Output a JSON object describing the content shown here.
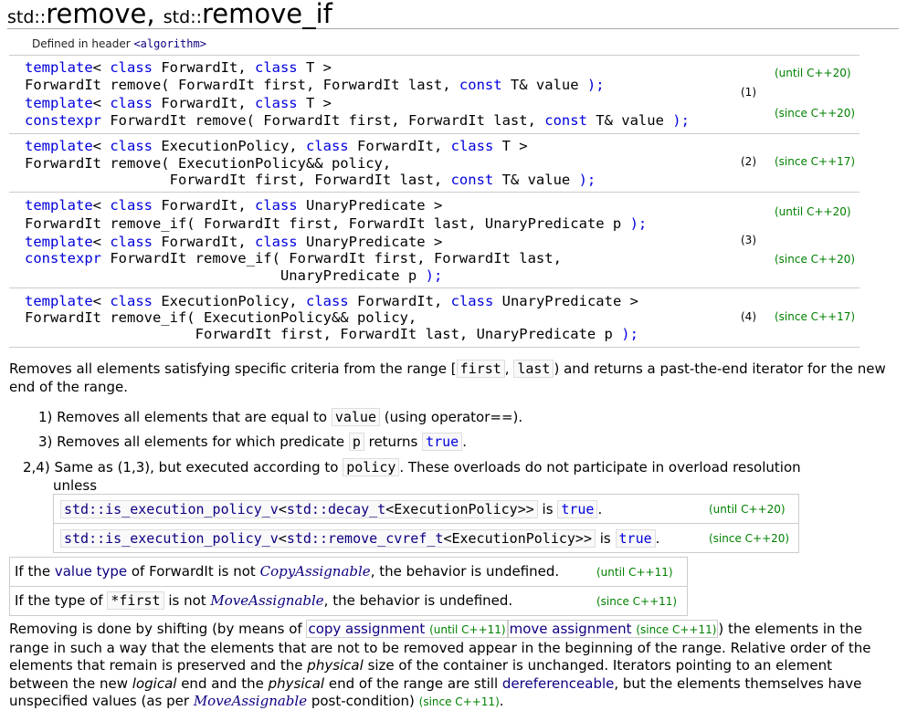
{
  "title": {
    "ns1": "std::",
    "name1": "remove",
    "sep": ", ",
    "ns2": "std::",
    "name2": "remove_if"
  },
  "header": {
    "prefix": "Defined in header ",
    "link": "<algorithm>"
  },
  "declarations": {
    "d1a": {
      "kw1": "template",
      "t1": "< ",
      "kw2": "class",
      "t2": " ForwardIt, ",
      "kw3": "class",
      "t3": " T >"
    },
    "d1b": {
      "t1": "ForwardIt remove( ForwardIt first, ForwardIt last, ",
      "kw1": "const",
      "t2": " T& value ",
      "p": ");"
    },
    "d1c": {
      "kw1": "template",
      "t1": "< ",
      "kw2": "class",
      "t2": " ForwardIt, ",
      "kw3": "class",
      "t3": " T >"
    },
    "d1d": {
      "kw1": "constexpr",
      "t1": " ForwardIt remove( ForwardIt first, ForwardIt last, ",
      "kw2": "const",
      "t2": " T& value ",
      "p": ");"
    },
    "d2a": {
      "kw1": "template",
      "t1": "< ",
      "kw2": "class",
      "t2": " ExecutionPolicy, ",
      "kw3": "class",
      "t3": " ForwardIt, ",
      "kw4": "class",
      "t4": " T >"
    },
    "d2b": {
      "t1": "ForwardIt remove( ExecutionPolicy&& policy,"
    },
    "d2c": {
      "t1": "                 ForwardIt first, ForwardIt last, ",
      "kw1": "const",
      "t2": " T& value ",
      "p": ");"
    },
    "d3a": {
      "kw1": "template",
      "t1": "< ",
      "kw2": "class",
      "t2": " ForwardIt, ",
      "kw3": "class",
      "t3": " UnaryPredicate >"
    },
    "d3b": {
      "t1": "ForwardIt remove_if( ForwardIt first, ForwardIt last, UnaryPredicate p ",
      "p": ");"
    },
    "d3c": {
      "kw1": "template",
      "t1": "< ",
      "kw2": "class",
      "t2": " ForwardIt, ",
      "kw3": "class",
      "t3": " UnaryPredicate >"
    },
    "d3d": {
      "kw1": "constexpr",
      "t1": " ForwardIt remove_if( ForwardIt first, ForwardIt last,"
    },
    "d3e": {
      "t1": "                              UnaryPredicate p ",
      "p": ");"
    },
    "d4a": {
      "kw1": "template",
      "t1": "< ",
      "kw2": "class",
      "t2": " ExecutionPolicy, ",
      "kw3": "class",
      "t3": " ForwardIt, ",
      "kw4": "class",
      "t4": " UnaryPredicate >"
    },
    "d4b": {
      "t1": "ForwardIt remove_if( ExecutionPolicy&& policy,"
    },
    "d4c": {
      "t1": "                    ForwardIt first, ForwardIt last, UnaryPredicate p ",
      "p": ");"
    }
  },
  "versions": {
    "until20": "(until C++20)",
    "since20": "(since C++20)",
    "since17": "(since C++17)",
    "until11": "(until C++11)",
    "since11": "(since C++11)"
  },
  "numbers": {
    "n1": "(1)",
    "n2": "(2)",
    "n3": "(3)",
    "n4": "(4)"
  },
  "intro": {
    "t1": "Removes all elements satisfying specific criteria from the range [",
    "c1": "first",
    "t2": ", ",
    "c2": "last",
    "t3": ") and returns a past-the-end iterator for the new end of the range."
  },
  "items": {
    "i1": {
      "label": "1)",
      "t1": " Removes all elements that are equal to ",
      "c1": "value",
      "t2": " (using operator==)."
    },
    "i3": {
      "label": "3)",
      "t1": " Removes all elements for which predicate ",
      "c1": "p",
      "t2": " returns ",
      "c2": "true",
      "t3": "."
    },
    "i24": {
      "label": "2,4)",
      "t1": " Same as (1,3), but executed according to ",
      "c1": "policy",
      "t2": ". These overloads do not participate in overload resolution",
      "t3": "unless"
    }
  },
  "policy": {
    "row1_a": "std::is_execution_policy_v",
    "row1_b": "<",
    "row1_c": "std::decay_t",
    "row1_d": "<ExecutionPolicy>>",
    "row1_is": " is ",
    "row1_true": "true",
    "row1_dot": ".",
    "row2_a": "std::is_execution_policy_v",
    "row2_b": "<",
    "row2_c": "std::remove_cvref_t",
    "row2_d": "<ExecutionPolicy>>",
    "row2_is": " is ",
    "row2_true": "true",
    "row2_dot": "."
  },
  "undefined": {
    "r1_t1": "If the ",
    "r1_link": "value type",
    "r1_t2": " of ForwardIt is not ",
    "r1_concept": "CopyAssignable",
    "r1_t3": ", the behavior is undefined.",
    "r2_t1": "If the type of ",
    "r2_code": "*first",
    "r2_t2": " is not ",
    "r2_concept": "MoveAssignable",
    "r2_t3": ", the behavior is undefined."
  },
  "removing": {
    "t1": "Removing is done by shifting (by means of ",
    "link1": "copy assignment",
    "link2": "move assignment",
    "t2": ") the elements in the range in such a way that the elements that are not to be removed appear in the beginning of the range. Relative order of the elements that remain is preserved and the ",
    "i1": "physical",
    "t3": " size of the container is unchanged. Iterators pointing to an element between the new ",
    "i2": "logical",
    "t4": " end and the ",
    "i3": "physical",
    "t5": " end of the range are still ",
    "link3": "dereferenceable",
    "t6": ", but the elements themselves have unspecified values (as per ",
    "concept": "MoveAssignable",
    "t7": " post-condition) ",
    "t8": "."
  }
}
